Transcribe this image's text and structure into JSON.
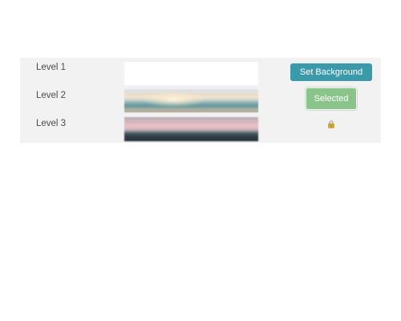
{
  "levels": [
    {
      "label": "Level 1",
      "background": "none",
      "action": "Set Background"
    },
    {
      "label": "Level 2",
      "background": "sunset-sea",
      "action": "Selected"
    },
    {
      "label": "Level 3",
      "background": "pink-dusk",
      "action_icon": "lock-icon"
    }
  ],
  "colors": {
    "panel": "#f2f2f2",
    "set_button": "#3b9aaa",
    "selected_button": "#8bc48a",
    "label_text": "#4a4a4a"
  }
}
